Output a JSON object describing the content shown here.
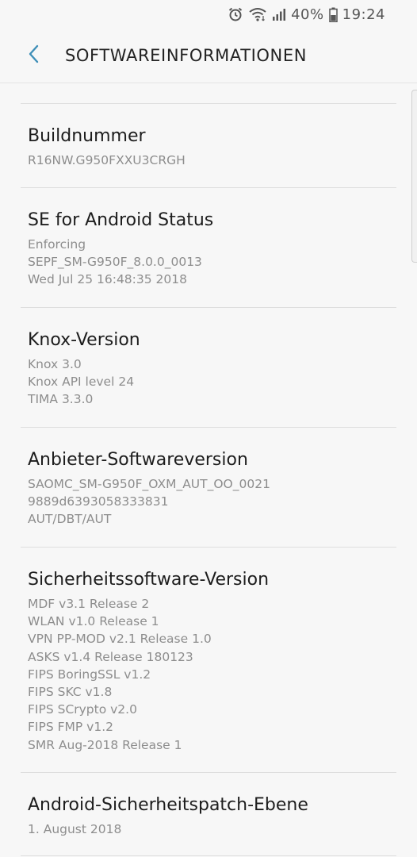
{
  "status_bar": {
    "icons": [
      "alarm-icon",
      "wifi-icon",
      "signal-icon"
    ],
    "battery": "40%",
    "time": "19:24"
  },
  "app_bar": {
    "back_icon": "chevron-left-icon",
    "title": "SOFTWAREINFORMATIONEN"
  },
  "sections": [
    {
      "title": "Buildnummer",
      "lines": [
        "R16NW.G950FXXU3CRGH"
      ]
    },
    {
      "title": "SE for Android Status",
      "lines": [
        "Enforcing",
        "SEPF_SM-G950F_8.0.0_0013",
        "Wed Jul 25 16:48:35 2018"
      ]
    },
    {
      "title": "Knox-Version",
      "lines": [
        "Knox 3.0",
        "Knox API level 24",
        "TIMA 3.3.0"
      ]
    },
    {
      "title": "Anbieter-Softwareversion",
      "lines": [
        "SAOMC_SM-G950F_OXM_AUT_OO_0021",
        "9889d6393058333831",
        "AUT/DBT/AUT"
      ]
    },
    {
      "title": "Sicherheitssoftware-Version",
      "lines": [
        "MDF v3.1 Release 2",
        "WLAN v1.0 Release 1",
        "VPN PP-MOD v2.1 Release 1.0",
        "ASKS v1.4 Release 180123",
        "FIPS BoringSSL v1.2",
        "FIPS SKC v1.8",
        "FIPS SCrypto v2.0",
        "FIPS FMP v1.2",
        "SMR Aug-2018 Release 1"
      ]
    },
    {
      "title": "Android-Sicherheitspatch-Ebene",
      "lines": [
        "1. August 2018"
      ]
    }
  ]
}
